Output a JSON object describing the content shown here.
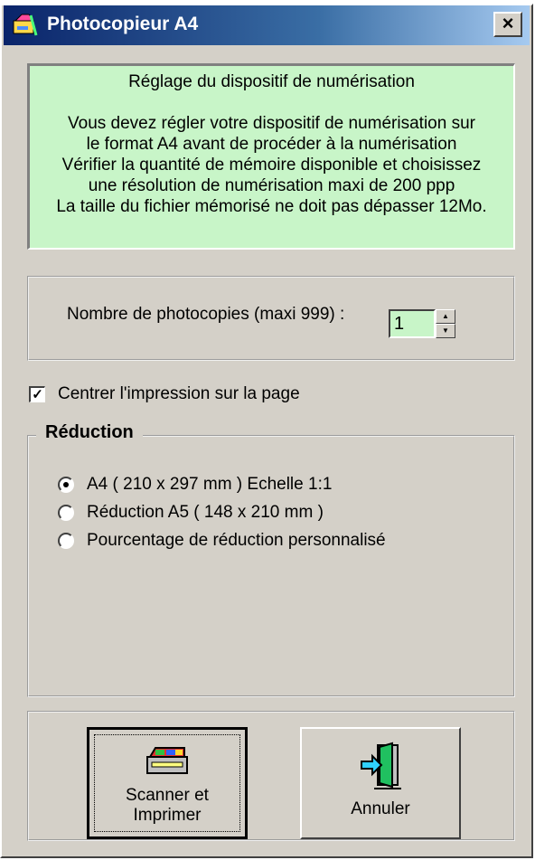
{
  "window": {
    "title": "Photocopieur A4",
    "close_label": "×"
  },
  "info": {
    "title": "Réglage du dispositif de numérisation",
    "lines": [
      "Vous devez régler votre dispositif de numérisation sur",
      "le format A4 avant de procéder à la numérisation",
      "Vérifier la quantité de mémoire disponible et choisissez",
      "une résolution de numérisation maxi de 200 ppp",
      "La taille du fichier mémorisé ne doit pas dépasser 12Mo."
    ],
    "background": "#c8f5c8"
  },
  "copies": {
    "label": "Nombre de photocopies (maxi 999) :",
    "value": "1"
  },
  "center_print": {
    "label": "Centrer l'impression sur la page",
    "checked": true
  },
  "reduction": {
    "legend": "Réduction",
    "options": [
      {
        "label": "A4 ( 210 x 297 mm ) Echelle 1:1",
        "checked": true
      },
      {
        "label": "Réduction A5 ( 148 x 210 mm )",
        "checked": false
      },
      {
        "label": "Pourcentage de réduction personnalisé",
        "checked": false
      }
    ]
  },
  "buttons": {
    "scan": {
      "line1": "Scanner et",
      "line2": "Imprimer",
      "icon": "scanner-icon"
    },
    "cancel": {
      "label": "Annuler",
      "icon": "exit-door-icon"
    }
  },
  "colors": {
    "titlebar_start": "#0a246a",
    "titlebar_end": "#a6caf0",
    "dialog_face": "#d4d0c8"
  }
}
